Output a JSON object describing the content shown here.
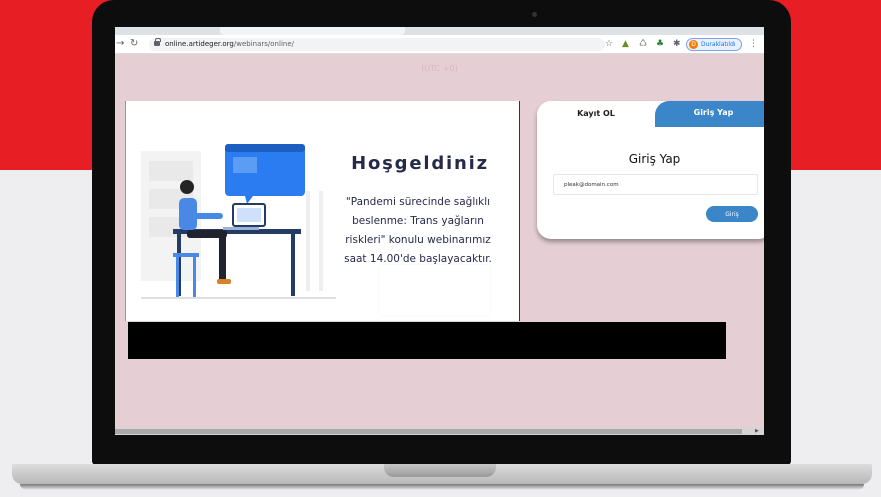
{
  "browser": {
    "url_domain": "online.artideger.org",
    "url_path": "/webinars/online/",
    "profile_initial": "D",
    "profile_name": "Duraklatıldı"
  },
  "page": {
    "timezone": "(UTC +0)",
    "welcome": {
      "title": "Hoşgeldiniz",
      "description_line1": "\"Pandemi sürecinde sağlıklı",
      "description_line2": "beslenme: Trans yağların",
      "description_line3": "riskleri\" konulu webinarımız",
      "description_line4": "saat 14.00'de başlayacaktır."
    },
    "login": {
      "tab_register": "Kayıt OL",
      "tab_login": "Giriş Yap",
      "heading": "Giriş Yap",
      "email_value": "pleak@domain.com",
      "submit_label": "Giriş"
    }
  },
  "colors": {
    "background_red": "#e81e25",
    "page_background": "#e6cfd4",
    "accent_blue": "#3a86c8",
    "heading_navy": "#262a4a"
  }
}
